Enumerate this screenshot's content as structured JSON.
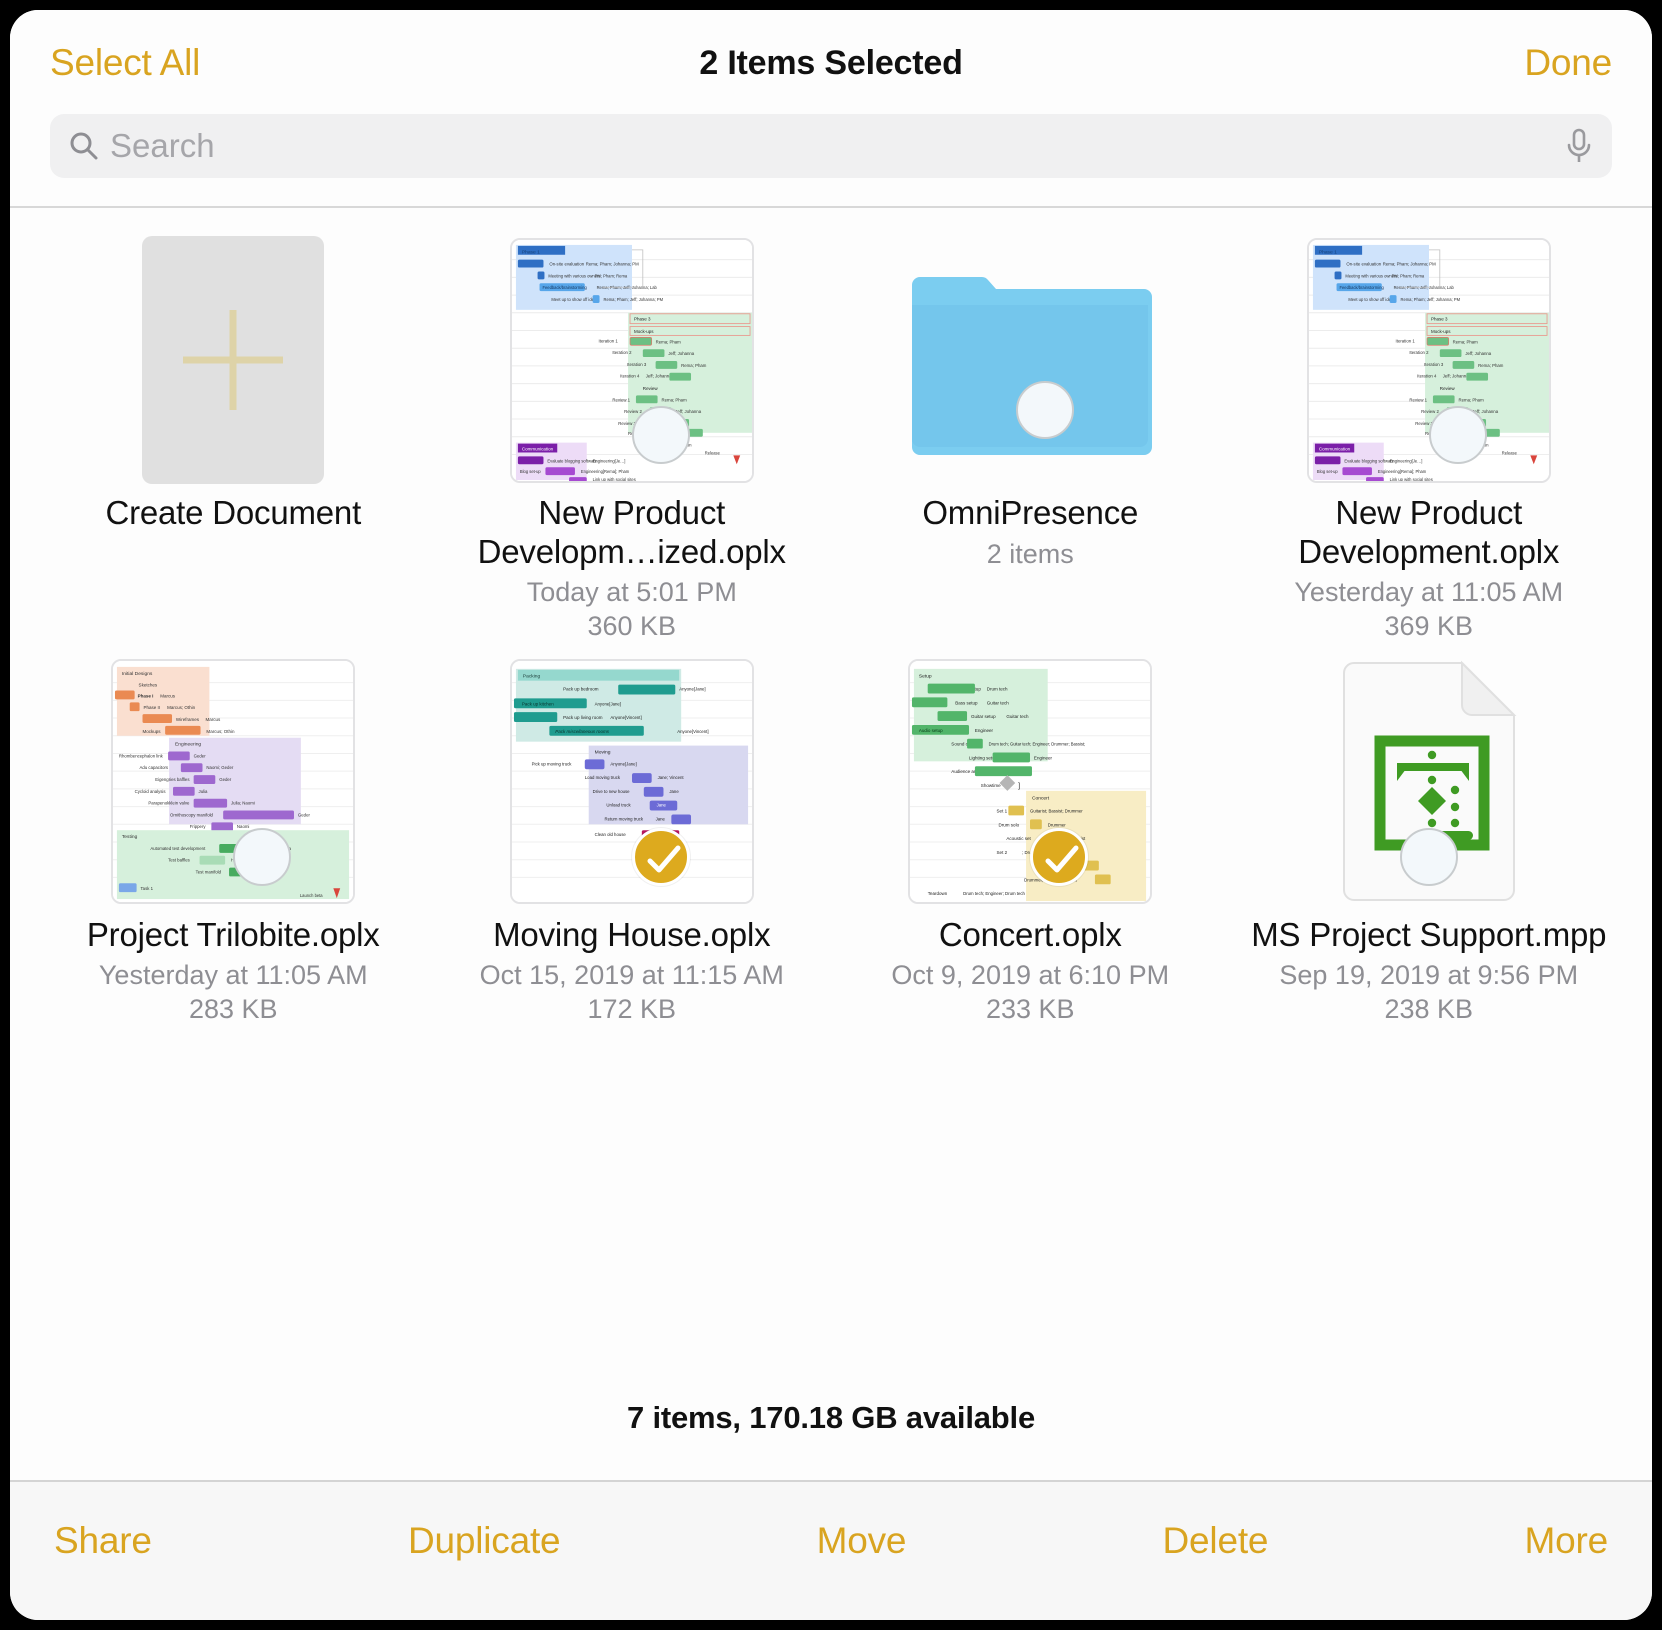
{
  "header": {
    "select_all_label": "Select All",
    "title": "2 Items Selected",
    "done_label": "Done"
  },
  "search": {
    "placeholder": "Search",
    "value": "",
    "search_icon": "search-icon",
    "mic_icon": "microphone-icon"
  },
  "items": [
    {
      "kind": "create",
      "title": "Create Document",
      "date": "",
      "size": "",
      "selected": false,
      "has_badge": false
    },
    {
      "kind": "oplx",
      "title": "New Product Developm…ized.oplx",
      "date": "Today at 5:01 PM",
      "size": "360 KB",
      "selected": false,
      "has_badge": true
    },
    {
      "kind": "folder",
      "title": "OmniPresence",
      "date": "2 items",
      "size": "",
      "selected": false,
      "has_badge": true
    },
    {
      "kind": "oplx",
      "title": "New Product Development.oplx",
      "date": "Yesterday at 11:05 AM",
      "size": "369 KB",
      "selected": false,
      "has_badge": true
    },
    {
      "kind": "trilobite",
      "title": "Project Trilobite.oplx",
      "date": "Yesterday at 11:05 AM",
      "size": "283 KB",
      "selected": false,
      "has_badge": true
    },
    {
      "kind": "moving",
      "title": "Moving House.oplx",
      "date": "Oct 15, 2019 at 11:15 AM",
      "size": "172 KB",
      "selected": true,
      "has_badge": true
    },
    {
      "kind": "concert",
      "title": "Concert.oplx",
      "date": "Oct 9, 2019 at 6:10 PM",
      "size": "233 KB",
      "selected": true,
      "has_badge": true
    },
    {
      "kind": "mpp",
      "title": "MS Project Support.mpp",
      "date": "Sep 19, 2019 at 9:56 PM",
      "size": "238 KB",
      "selected": false,
      "has_badge": true
    }
  ],
  "status": {
    "text": "7 items, 170.18 GB available"
  },
  "toolbar": {
    "share_label": "Share",
    "duplicate_label": "Duplicate",
    "move_label": "Move",
    "delete_label": "Delete",
    "more_label": "More"
  },
  "colors": {
    "accent": "#d9a420",
    "selected_badge": "#ddaa1e",
    "folder": "#6fc7ef",
    "mpp_green": "#3f9b23",
    "flag_red": "#d9453c"
  }
}
